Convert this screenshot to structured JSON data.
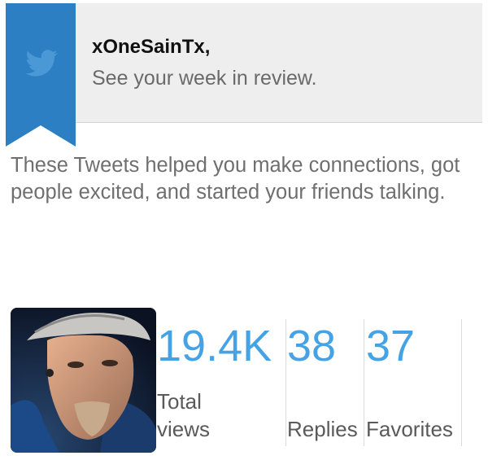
{
  "header": {
    "title": "xOneSainTx,",
    "subtitle": "See your week in review.",
    "icon": "twitter-bird-icon",
    "ribbon_color": "#2b7fc2"
  },
  "description": "These Tweets helped you make connections, got people excited, and started your friends talking.",
  "profile": {
    "avatar": "user-avatar-photo"
  },
  "stats": [
    {
      "value": "19.4K",
      "label_lines": [
        "Total",
        "views"
      ]
    },
    {
      "value": "38",
      "label_lines": [
        "Replies"
      ]
    },
    {
      "value": "37",
      "label_lines": [
        "Favorites"
      ]
    }
  ],
  "colors": {
    "accent": "#45a3e5",
    "header_bg": "#eeeeee"
  }
}
